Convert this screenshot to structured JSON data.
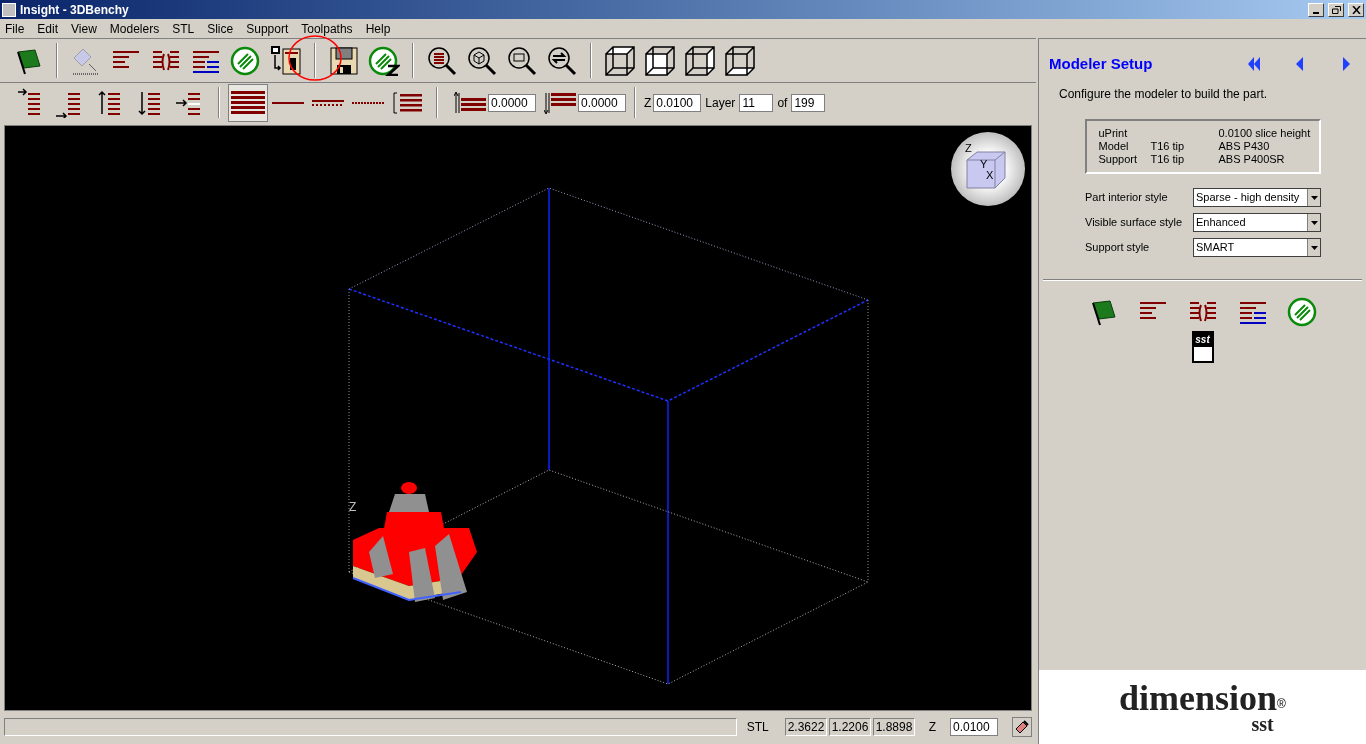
{
  "window": {
    "title": "Insight - 3DBenchy"
  },
  "menu": [
    "File",
    "Edit",
    "View",
    "Modelers",
    "STL",
    "Slice",
    "Support",
    "Toolpaths",
    "Help"
  ],
  "toolbar2": {
    "offset_fields": [
      "0.0000",
      "0.0000"
    ],
    "z_label": "Z",
    "z_value": "0.0100",
    "layer_label": "Layer",
    "layer_value": "11",
    "of_label": "of",
    "of_value": "199"
  },
  "viewport": {
    "axis_label": "Z",
    "view_cube": [
      "Z",
      "Y",
      "X"
    ]
  },
  "status_bar": {
    "stl_label": "STL",
    "values": [
      "2.3622",
      "1.2206",
      "1.8898"
    ],
    "z_label": "Z",
    "z_value": "0.0100"
  },
  "panel": {
    "title": "Modeler Setup",
    "description": "Configure the modeler to build the part.",
    "info": [
      {
        "label": "uPrint",
        "value": "0.0100 slice height"
      },
      {
        "label": "Model",
        "tip": "T16 tip",
        "value": "ABS P430"
      },
      {
        "label": "Support",
        "tip": "T16 tip",
        "value": "ABS P400SR"
      }
    ],
    "settings": [
      {
        "label": "Part interior style",
        "value": "Sparse - high density"
      },
      {
        "label": "Visible surface style",
        "value": "Enhanced"
      },
      {
        "label": "Support style",
        "value": "SMART"
      }
    ],
    "sst_label": "sst",
    "logo": {
      "word": "dimension",
      "mark": "®",
      "sub": "sst"
    }
  }
}
